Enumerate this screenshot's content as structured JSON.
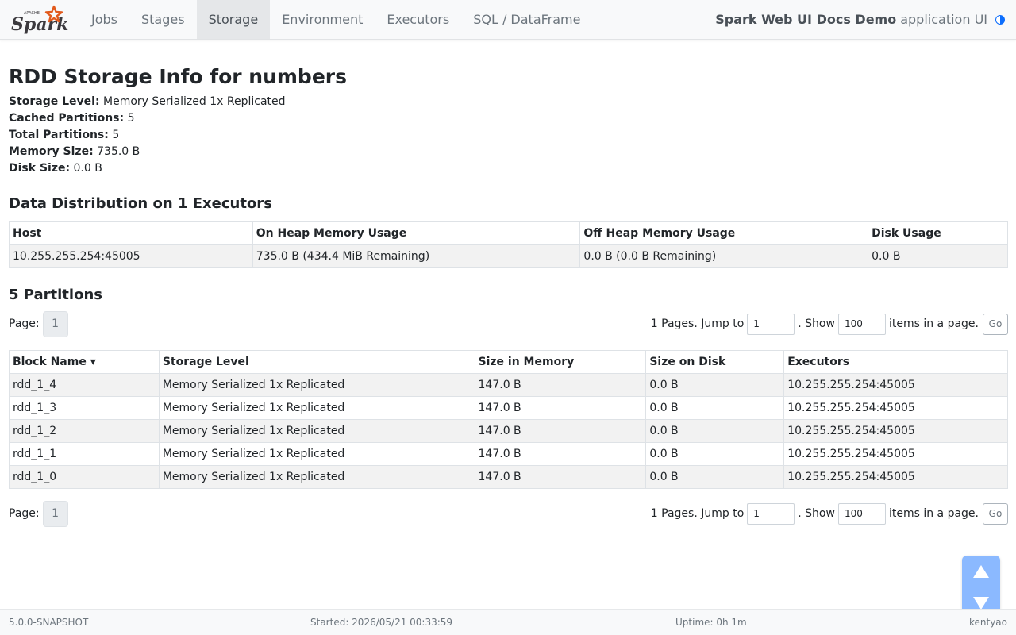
{
  "brand": {
    "logo_small": "APACHE",
    "logo_main": "Spark"
  },
  "nav": {
    "items": [
      {
        "label": "Jobs"
      },
      {
        "label": "Stages"
      },
      {
        "label": "Storage"
      },
      {
        "label": "Environment"
      },
      {
        "label": "Executors"
      },
      {
        "label": "SQL / DataFrame"
      }
    ],
    "active": "Storage",
    "app_name": "Spark Web UI Docs Demo",
    "app_suffix": "application UI",
    "theme_icon": "half-circle-icon"
  },
  "page": {
    "title": "RDD Storage Info for numbers",
    "summary": [
      {
        "label": "Storage Level:",
        "value": "Memory Serialized 1x Replicated"
      },
      {
        "label": "Cached Partitions:",
        "value": "5"
      },
      {
        "label": "Total Partitions:",
        "value": "5"
      },
      {
        "label": "Memory Size:",
        "value": "735.0 B"
      },
      {
        "label": "Disk Size:",
        "value": "0.0 B"
      }
    ]
  },
  "distribution": {
    "heading": "Data Distribution on 1 Executors",
    "columns": [
      "Host",
      "On Heap Memory Usage",
      "Off Heap Memory Usage",
      "Disk Usage"
    ],
    "rows": [
      [
        "10.255.255.254:45005",
        "735.0 B (434.4 MiB Remaining)",
        "0.0 B (0.0 B Remaining)",
        "0.0 B"
      ]
    ]
  },
  "partitions": {
    "heading": "5 Partitions",
    "pager": {
      "page_label": "Page:",
      "current_page": "1",
      "pages_text": "1 Pages. Jump to",
      "jump_value": "1",
      "show_text": ". Show",
      "size_value": "100",
      "items_text": "items in a page.",
      "go_label": "Go"
    },
    "columns": [
      "Block Name ▾",
      "Storage Level",
      "Size in Memory",
      "Size on Disk",
      "Executors"
    ],
    "rows": [
      [
        "rdd_1_4",
        "Memory Serialized 1x Replicated",
        "147.0 B",
        "0.0 B",
        "10.255.255.254:45005"
      ],
      [
        "rdd_1_3",
        "Memory Serialized 1x Replicated",
        "147.0 B",
        "0.0 B",
        "10.255.255.254:45005"
      ],
      [
        "rdd_1_2",
        "Memory Serialized 1x Replicated",
        "147.0 B",
        "0.0 B",
        "10.255.255.254:45005"
      ],
      [
        "rdd_1_1",
        "Memory Serialized 1x Replicated",
        "147.0 B",
        "0.0 B",
        "10.255.255.254:45005"
      ],
      [
        "rdd_1_0",
        "Memory Serialized 1x Replicated",
        "147.0 B",
        "0.0 B",
        "10.255.255.254:45005"
      ]
    ]
  },
  "footer": {
    "version": "5.0.0-SNAPSHOT",
    "started": "Started: 2026/05/21 00:33:59",
    "uptime": "Uptime: 0h 1m",
    "user": "kentyao"
  },
  "colors": {
    "scroll_button": "#8bb9ff",
    "logo_orange": "#e25a1c",
    "logo_text": "#3c3a3e",
    "theme_blue": "#0d6efd"
  }
}
